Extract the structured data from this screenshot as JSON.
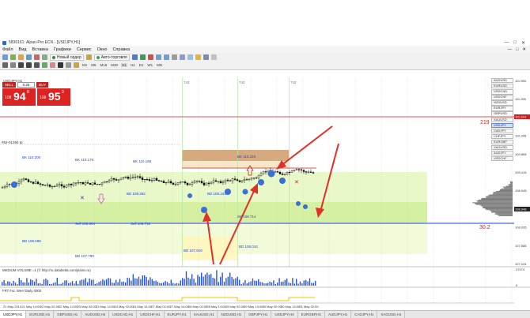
{
  "window": {
    "title": "5836161: Alpari-Pro.ECN - [USDJPY,H1]",
    "controls": [
      "—",
      "□",
      "✕"
    ]
  },
  "menu": {
    "items": [
      "Файл",
      "Вид",
      "Вставка",
      "Графики",
      "Сервис",
      "Окно",
      "Справка"
    ],
    "right_controls": [
      "—",
      "□",
      "✕"
    ]
  },
  "toolbar": {
    "new_order": "Новый ордер",
    "autotrading": "Авто-торговля",
    "timeframes": [
      "M1",
      "M5",
      "M15",
      "M30",
      "H1",
      "H4",
      "D1",
      "W1",
      "MN"
    ]
  },
  "trade_panel": {
    "sell_label": "SELL",
    "buy_label": "BUY",
    "lots": "0.25",
    "sell_price_small": "108",
    "sell_price_big": "94",
    "sell_price_sup": "8",
    "buy_price_small": "108",
    "buy_price_big": "95",
    "buy_price_sup": "0"
  },
  "chart": {
    "symbol_caption": "USDJPY,H1",
    "price_axis": [
      "111.955",
      "111.255",
      "110.805",
      "110.345",
      "109.865",
      "109.415",
      "108.945",
      "108.475",
      "108.035",
      "107.585",
      "107.115"
    ],
    "current_price": "108.948",
    "red_price": "111.244",
    "right_labels": [
      "219",
      "30.2"
    ],
    "level_labels": [
      "BK 110.200",
      "BK 110.170",
      "BK 110.188",
      "BD 109.392",
      "BD 109.341",
      "Sell 108.604",
      "Sell 108.718",
      "BD 107.790",
      "BD 107.910",
      "BD 108.010",
      "SK 108.714",
      "BK 110.220",
      "BD 108.588",
      "#62-01394 tp"
    ],
    "profile_numbers_top": [
      "742",
      "742",
      "742"
    ],
    "indicator_label": "MEDIUM VOLUME =1 (© http://ru.databetta.com/plains.ru)",
    "indicator_label2": "FRT Fut. Weel Daily 0000",
    "volume_axis": [
      "27074",
      "0"
    ],
    "time_labels": [
      "21 May 2013",
      "21 May 14:00",
      "22 May 02:00",
      "22 May 14:00",
      "23 May 02:00",
      "23 May 14:00",
      "24 May 02:00",
      "24 May 14:00",
      "27 May 02:00",
      "27 May 14:00",
      "28 May 02:00",
      "28 May 14:00",
      "29 May 02:00",
      "29 May 14:00",
      "30 May 02:00",
      "30 May 14:00",
      "31 May 02:00"
    ]
  },
  "symbols": [
    "AUDUSD",
    "EURUSD",
    "USDCAD",
    "USDCHF",
    "NZDUSD",
    "EURJPY",
    "GBPUSD",
    "XAUUSD",
    "USDJPY",
    "CADJPY",
    "CHFJPY",
    "EURGBP",
    "XAGUSD",
    "AUDJPY",
    "USDCHF"
  ],
  "active_symbol": "USDJPY",
  "tabs": [
    "USDJPY,H1",
    "EURUSD,H1",
    "GBPUSD,H1",
    "AUDUSD,H4",
    "USDCAD,H1",
    "USDCHF,H1",
    "EURJPY,H1",
    "XAUUSD,H1",
    "NZDUSD,H1",
    "GBPJPY,H1",
    "USDJPY,H4",
    "EURGBP,H1",
    "AUDJPY,H1",
    "CADJPY,H1",
    "XAGUSD,H1"
  ],
  "active_tab": "USDJPY,H1",
  "colors": {
    "background": "#ffffff",
    "candle": "#000000",
    "zone_green": "#e6f7c0",
    "zone_green_dark": "#c8ef8a",
    "zone_brown": "#d9a77a",
    "blue_line": "#1f3fd8",
    "red_line": "#cc1f1f",
    "arrow_red": "#e0302a",
    "bubble_blue": "#3a6fd8",
    "volume_blue": "#2c55d8",
    "indicator_yellow": "#f0c400"
  },
  "icons": [
    "chart-icon",
    "new-order-icon",
    "autotrading-icon",
    "zoom-in-icon",
    "zoom-out-icon",
    "crosshair-icon",
    "cursor-icon",
    "line-icon",
    "text-icon"
  ]
}
